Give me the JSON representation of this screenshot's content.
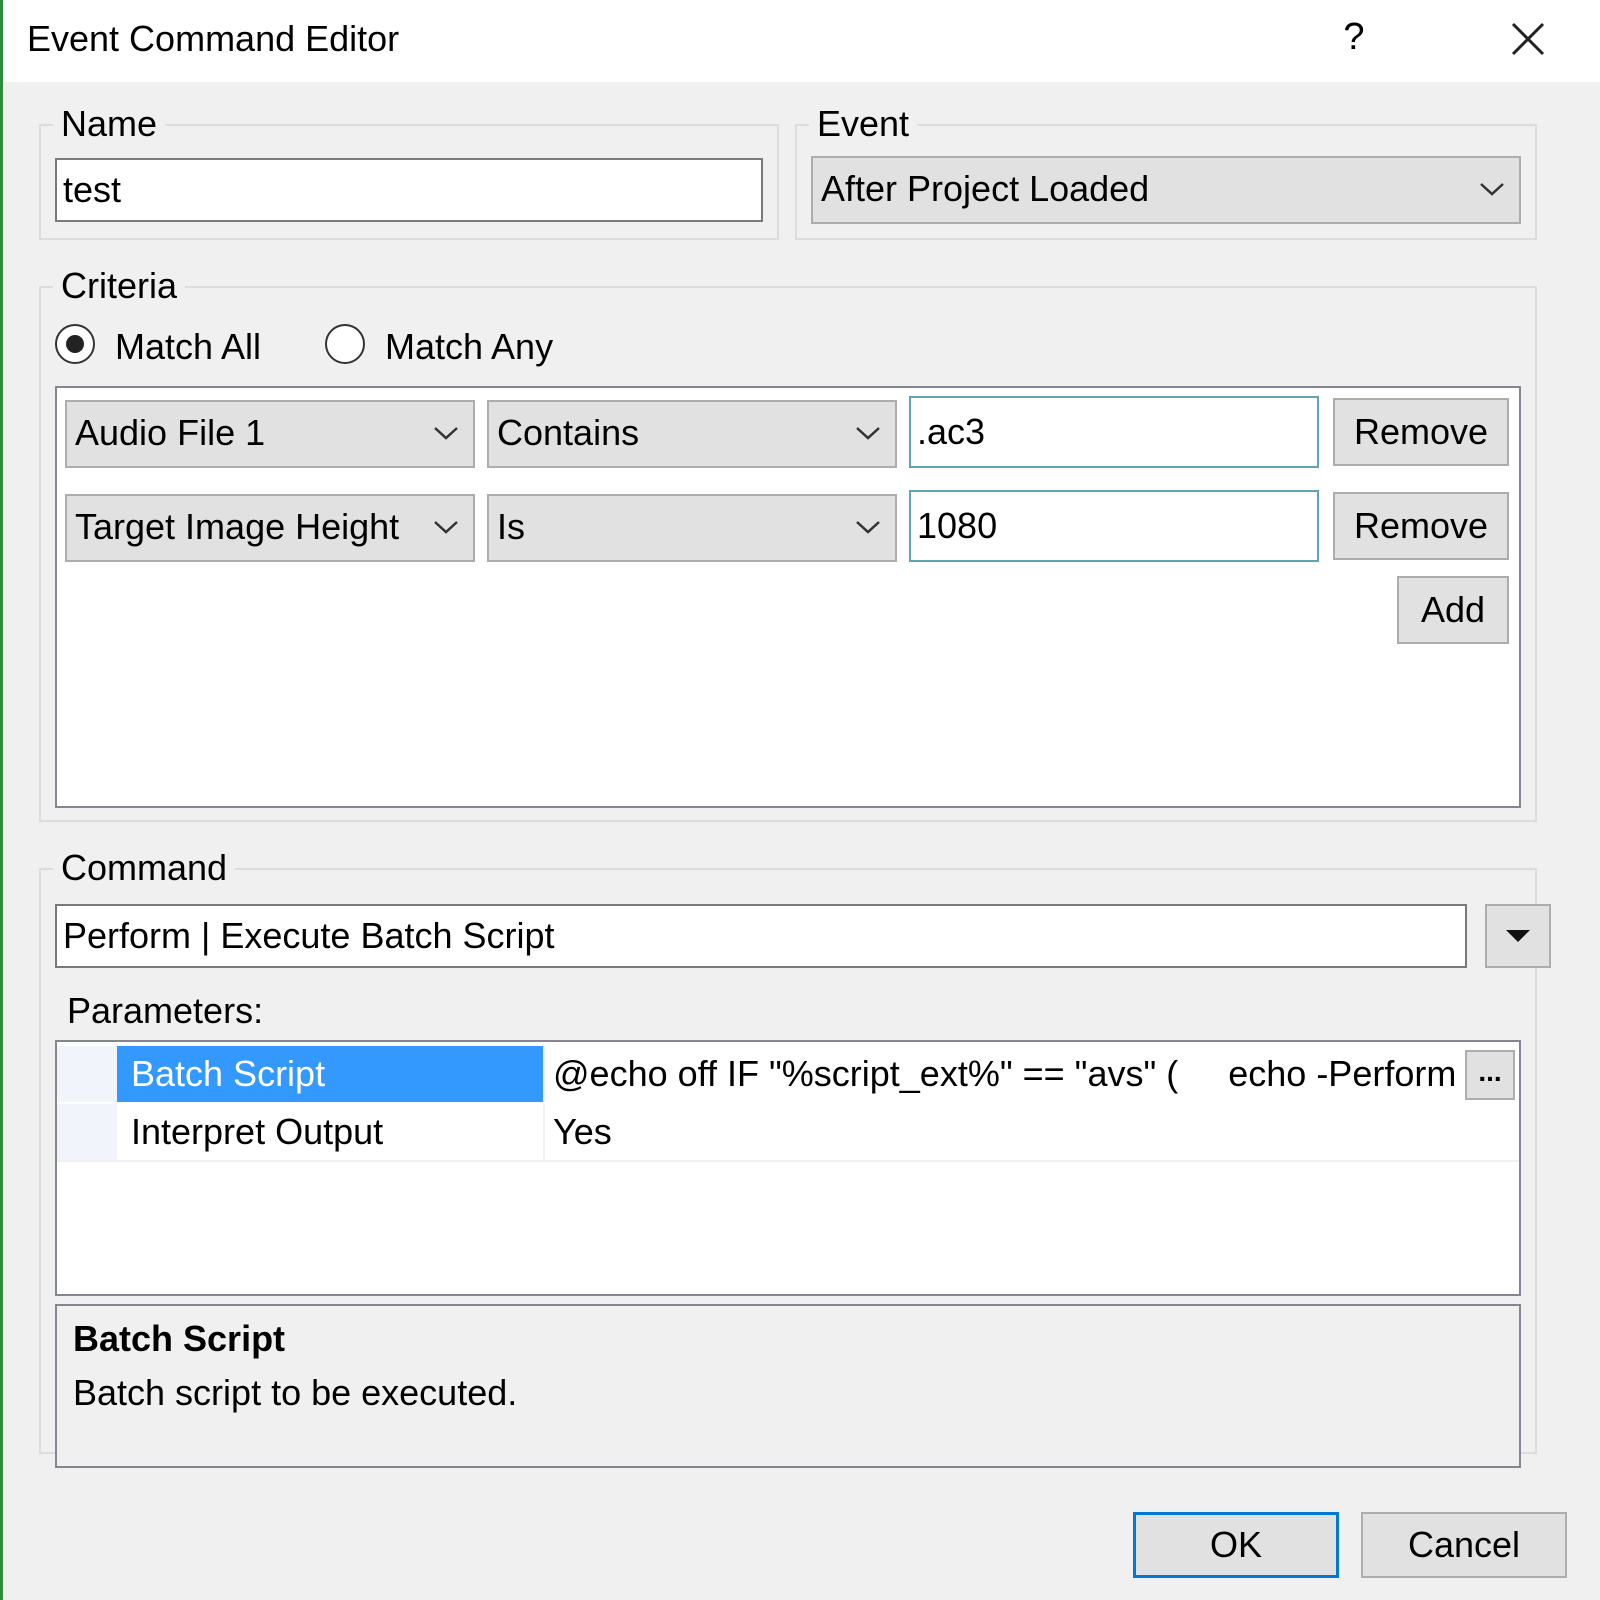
{
  "window": {
    "title": "Event Command Editor",
    "help_glyph": "?",
    "close_icon": "close-icon"
  },
  "name_group": {
    "label": "Name",
    "value": "test"
  },
  "event_group": {
    "label": "Event",
    "selected": "After Project Loaded"
  },
  "criteria": {
    "label": "Criteria",
    "match_all_label": "Match All",
    "match_any_label": "Match Any",
    "selected_mode": "Match All",
    "rows": [
      {
        "field": "Audio File 1",
        "operator": "Contains",
        "value": ".ac3",
        "remove_label": "Remove"
      },
      {
        "field": "Target Image Height",
        "operator": "Is",
        "value": "1080",
        "remove_label": "Remove"
      }
    ],
    "add_label": "Add"
  },
  "command": {
    "label": "Command",
    "value": "Perform | Execute Batch Script",
    "parameters_label": "Parameters:",
    "parameters": [
      {
        "name": "Batch Script",
        "value": "@echo off IF \"%script_ext%\" == \"avs\" (     echo -Perform",
        "selected": true
      },
      {
        "name": "Interpret Output",
        "value": "Yes",
        "selected": false
      }
    ],
    "ellipsis_label": "...",
    "description_title": "Batch Script",
    "description_text": "Batch script to be executed."
  },
  "footer": {
    "ok_label": "OK",
    "cancel_label": "Cancel"
  },
  "colors": {
    "selection": "#3399ff",
    "default_button_border": "#0078d7",
    "window_accent": "#2d8a3e"
  }
}
